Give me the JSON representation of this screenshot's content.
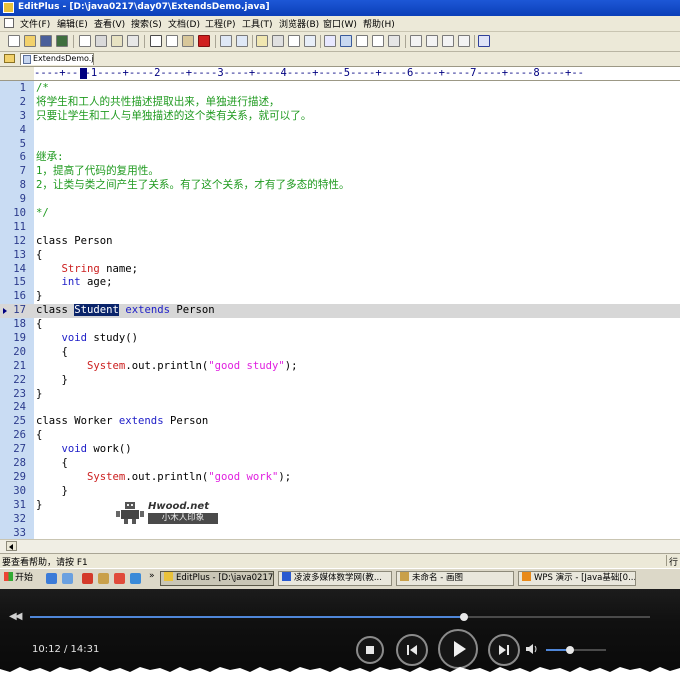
{
  "window": {
    "title": "EditPlus - [D:\\java0217\\day07\\ExtendsDemo.java]"
  },
  "menu": [
    {
      "label": "文件(F)"
    },
    {
      "label": "编辑(E)"
    },
    {
      "label": "查看(V)"
    },
    {
      "label": "搜索(S)"
    },
    {
      "label": "文档(D)"
    },
    {
      "label": "工程(P)"
    },
    {
      "label": "工具(T)"
    },
    {
      "label": "浏览器(B)"
    },
    {
      "label": "窗口(W)"
    },
    {
      "label": "帮助(H)"
    }
  ],
  "tab": {
    "filename": "ExtendsDemo.java"
  },
  "ruler": {
    "text": "----+----1----+----2----+----3----+----4----+----5----+----6----+----7----+----8----+--"
  },
  "code": [
    {
      "n": "1",
      "text": "/*"
    },
    {
      "n": "2",
      "text": "将学生和工人的共性描述提取出来，单独进行描述，"
    },
    {
      "n": "3",
      "text": "只要让学生和工人与单独描述的这个类有关系，就可以了。"
    },
    {
      "n": "4",
      "text": ""
    },
    {
      "n": "5",
      "text": ""
    },
    {
      "n": "6",
      "text": "继承:"
    },
    {
      "n": "7",
      "text": "1，提高了代码的复用性。"
    },
    {
      "n": "8",
      "text": "2，让类与类之间产生了关系。有了这个关系，才有了多态的特性。"
    },
    {
      "n": "9",
      "text": ""
    },
    {
      "n": "10",
      "text": "*/"
    },
    {
      "n": "11",
      "text": ""
    },
    {
      "n": "12",
      "text": "class Person"
    },
    {
      "n": "13",
      "text": "{"
    },
    {
      "n": "14",
      "text": "    String name;"
    },
    {
      "n": "15",
      "text": "    int age;"
    },
    {
      "n": "16",
      "text": "}"
    },
    {
      "n": "17",
      "text": "class Student extends Person"
    },
    {
      "n": "18",
      "text": "{"
    },
    {
      "n": "19",
      "text": "    void study()"
    },
    {
      "n": "20",
      "text": "    {"
    },
    {
      "n": "21",
      "text": "        System.out.println(\"good study\");"
    },
    {
      "n": "22",
      "text": "    }"
    },
    {
      "n": "23",
      "text": "}"
    },
    {
      "n": "24",
      "text": ""
    },
    {
      "n": "25",
      "text": "class Worker extends Person"
    },
    {
      "n": "26",
      "text": "{"
    },
    {
      "n": "27",
      "text": "    void work()"
    },
    {
      "n": "28",
      "text": "    {"
    },
    {
      "n": "29",
      "text": "        System.out.println(\"good work\");"
    },
    {
      "n": "30",
      "text": "    }"
    },
    {
      "n": "31",
      "text": "}"
    },
    {
      "n": "32",
      "text": ""
    },
    {
      "n": "33",
      "text": ""
    }
  ],
  "watermark": {
    "brand": "Hwood.net",
    "sub": "小木人印象"
  },
  "status": {
    "text": "要查看帮助，请按 F1",
    "right": "行"
  },
  "taskbar": {
    "start": "开始",
    "tasks": [
      {
        "label": "EditPlus - [D:\\java0217\\..."
      },
      {
        "label": "凌波多媒体数学网(教..."
      },
      {
        "label": "未命名 - 画图"
      },
      {
        "label": "WPS 演示 - [Java基础[0..."
      }
    ]
  },
  "player": {
    "time": "10:12 / 14:31",
    "progress": 0.7,
    "volume": 0.4
  },
  "colors": {
    "titlebar": "#0b3fb8",
    "keyword": "#2020c8",
    "comment": "#1f9a1f",
    "string": "#e020e0",
    "type": "#cc2020",
    "selection": "#0a246a"
  }
}
